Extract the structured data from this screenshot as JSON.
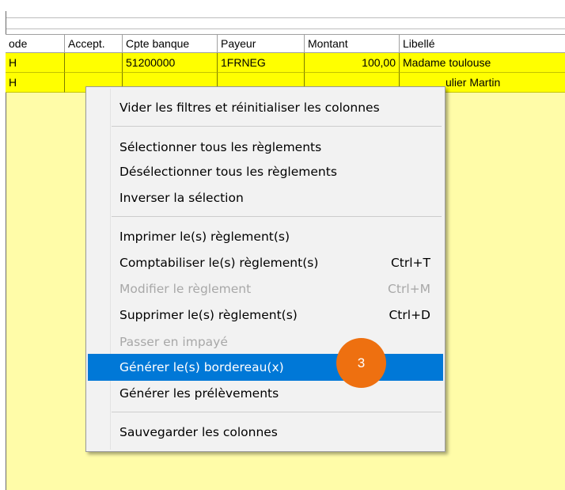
{
  "grid": {
    "columns": [
      "ode",
      "Accept.",
      "Cpte banque",
      "Payeur",
      "Montant",
      "Libellé"
    ],
    "rows": [
      {
        "code": "H",
        "accept": "",
        "cpte": "51200000",
        "payeur": "1FRNEG",
        "montant": "100,00",
        "libelle": "Madame toulouse"
      },
      {
        "code": "H",
        "accept": "",
        "cpte": "",
        "payeur": "",
        "montant": "",
        "libelle": "ulier Martin"
      }
    ]
  },
  "menu": {
    "reset_filters": "Vider les filtres et réinitialiser les colonnes",
    "select_all": "Sélectionner tous les règlements",
    "deselect_all": "Désélectionner tous les règlements",
    "invert": "Inverser la sélection",
    "print": "Imprimer le(s) règlement(s)",
    "post": "Comptabiliser le(s) règlement(s)",
    "post_sc": "Ctrl+T",
    "modify": "Modifier le règlement",
    "modify_sc": "Ctrl+M",
    "delete": "Supprimer le(s) règlement(s)",
    "delete_sc": "Ctrl+D",
    "unpaid": "Passer en impayé",
    "generate_slips": "Générer le(s) bordereau(x)",
    "generate_debits": "Générer les prélèvements",
    "save_columns": "Sauvegarder les colonnes"
  },
  "annotation": {
    "step": "3",
    "color": "#ee7010"
  },
  "colors": {
    "row_highlight": "#ffff00",
    "background": "#fffca8",
    "menu_highlight": "#0078d7"
  }
}
